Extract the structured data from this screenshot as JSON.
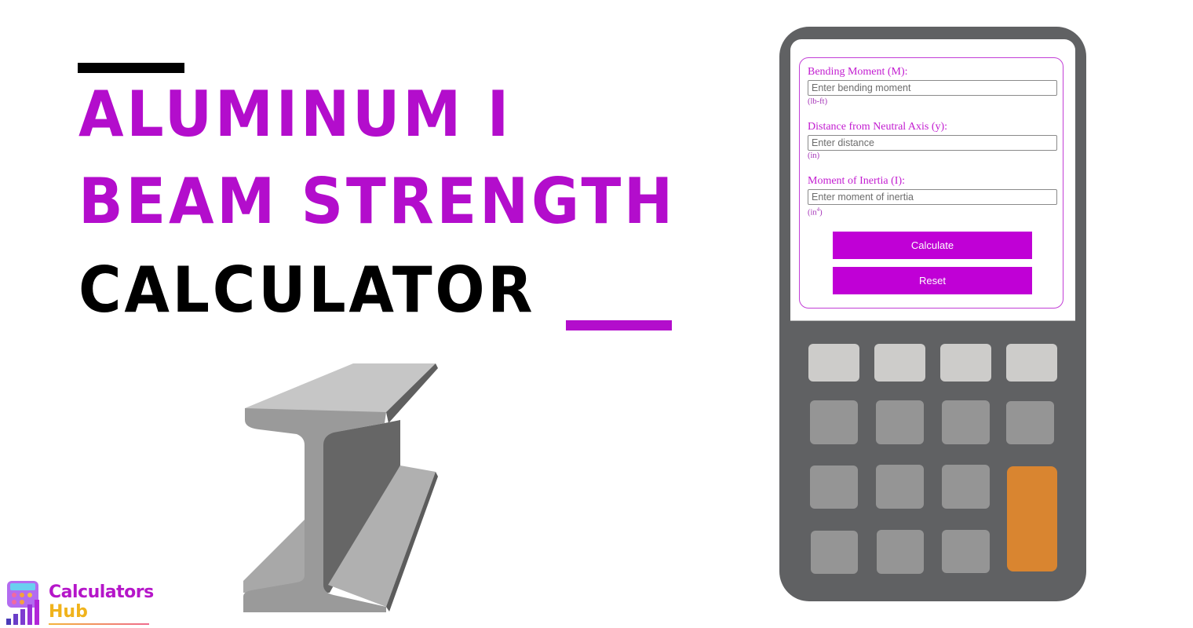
{
  "title": {
    "line1": "Aluminum I",
    "line2": "Beam Strength",
    "line3": "Calculator",
    "accent_color": "#b30dcc"
  },
  "logo": {
    "name_line1": "Calculators",
    "name_line2": "Hub"
  },
  "calculator": {
    "fields": [
      {
        "label": "Bending Moment (M):",
        "placeholder": "Enter bending moment",
        "value": "",
        "unit": "(lb-ft)"
      },
      {
        "label": "Distance from Neutral Axis (y):",
        "placeholder": "Enter distance",
        "value": "",
        "unit": "(in)"
      },
      {
        "label": "Moment of Inertia (I):",
        "placeholder": "Enter moment of inertia",
        "value": "",
        "unit_base": "(in",
        "unit_sup": "4",
        "unit_close": ")"
      }
    ],
    "buttons": {
      "calculate": "Calculate",
      "reset": "Reset"
    },
    "button_color": "#c000d6",
    "key_colors": {
      "top_row": "#cdccca",
      "keys": "#959595",
      "equals": "#d98530",
      "body": "#606163"
    }
  }
}
